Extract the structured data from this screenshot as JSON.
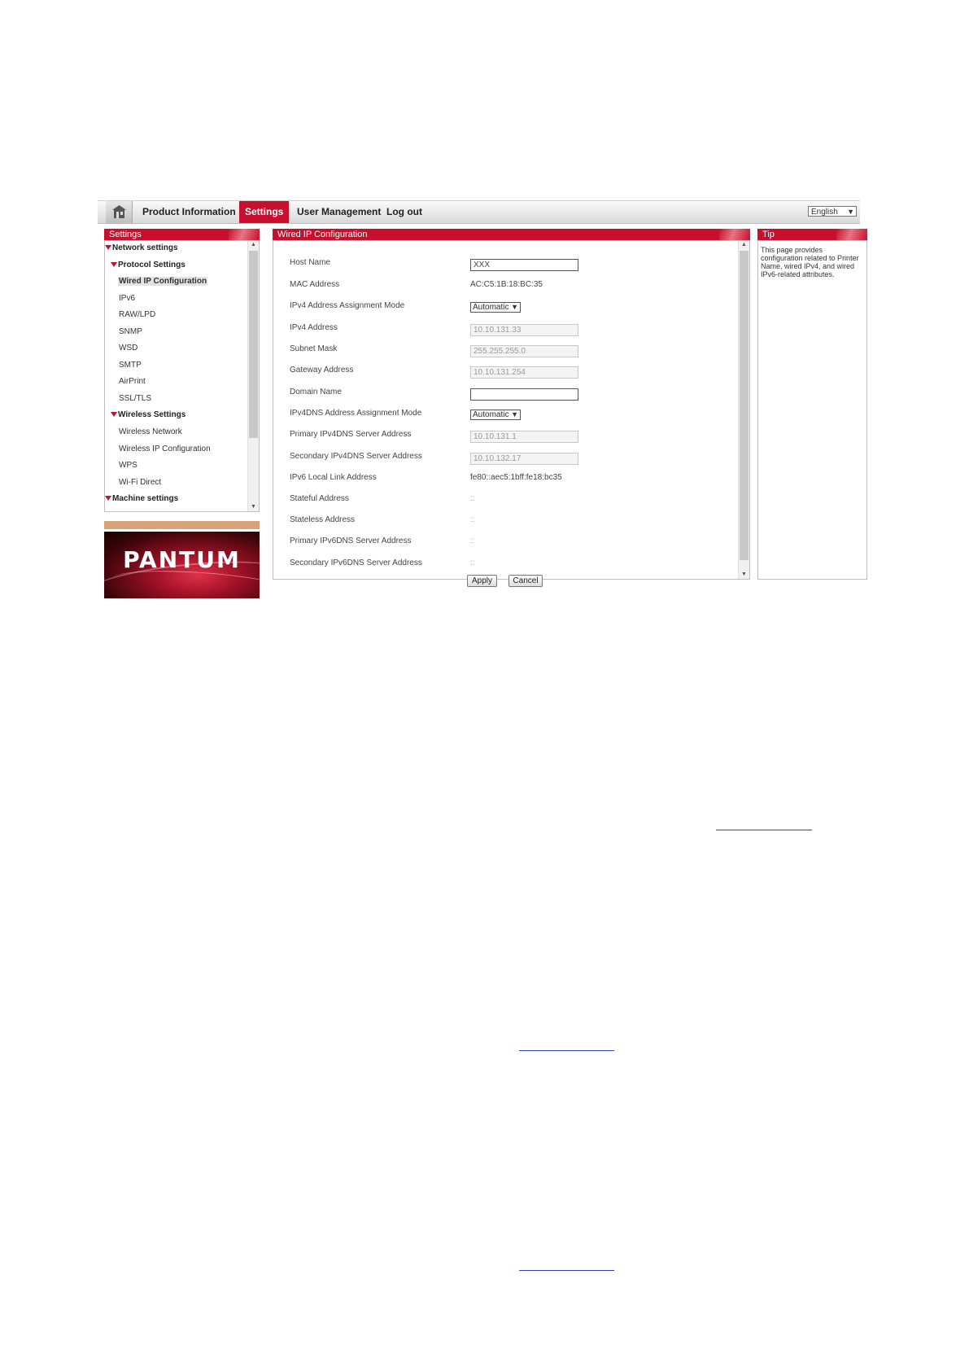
{
  "nav": {
    "items": [
      "Product Information",
      "Settings",
      "User Management",
      "Log out"
    ],
    "active": "Settings",
    "language": "English"
  },
  "sidebar": {
    "title": "Settings",
    "items": [
      {
        "label": "Network settings",
        "type": "group"
      },
      {
        "label": "Protocol Settings",
        "type": "group"
      },
      {
        "label": "Wired IP Configuration",
        "type": "item",
        "selected": true
      },
      {
        "label": "IPv6",
        "type": "item"
      },
      {
        "label": "RAW/LPD",
        "type": "item"
      },
      {
        "label": "SNMP",
        "type": "item"
      },
      {
        "label": "WSD",
        "type": "item"
      },
      {
        "label": "SMTP",
        "type": "item"
      },
      {
        "label": "AirPrint",
        "type": "item"
      },
      {
        "label": "SSL/TLS",
        "type": "item"
      },
      {
        "label": "Wireless Settings",
        "type": "group"
      },
      {
        "label": "Wireless Network",
        "type": "item"
      },
      {
        "label": "Wireless IP Configuration",
        "type": "item"
      },
      {
        "label": "WPS",
        "type": "item"
      },
      {
        "label": "Wi-Fi Direct",
        "type": "item"
      },
      {
        "label": "Machine settings",
        "type": "group"
      }
    ]
  },
  "brand": {
    "logo_text": "PANTUM"
  },
  "main": {
    "title": "Wired IP Configuration",
    "fields": [
      {
        "label": "Host Name",
        "kind": "input",
        "value": "XXX"
      },
      {
        "label": "MAC Address",
        "kind": "text",
        "value": "AC:C5:1B:18:BC:35"
      },
      {
        "label": "IPv4 Address Assignment Mode",
        "kind": "select",
        "value": "Automatic"
      },
      {
        "label": "IPv4 Address",
        "kind": "input-disabled",
        "value": "10.10.131.33"
      },
      {
        "label": "Subnet Mask",
        "kind": "input-disabled",
        "value": "255.255.255.0"
      },
      {
        "label": "Gateway Address",
        "kind": "input-disabled",
        "value": "10.10.131.254"
      },
      {
        "label": "Domain Name",
        "kind": "input",
        "value": ""
      },
      {
        "label": "IPv4DNS Address Assignment Mode",
        "kind": "select",
        "value": "Automatic"
      },
      {
        "label": "Primary IPv4DNS Server Address",
        "kind": "input-disabled",
        "value": "10.10.131.1"
      },
      {
        "label": "Secondary IPv4DNS Server Address",
        "kind": "input-disabled",
        "value": "10.10.132.17"
      },
      {
        "label": "IPv6 Local Link Address",
        "kind": "text",
        "value": "fe80::aec5:1bff:fe18:bc35"
      },
      {
        "label": "Stateful Address",
        "kind": "text-light",
        "value": "::"
      },
      {
        "label": "Stateless Address",
        "kind": "text-light",
        "value": "::"
      },
      {
        "label": "Primary IPv6DNS Server Address",
        "kind": "text-light",
        "value": "::"
      },
      {
        "label": "Secondary IPv6DNS Server Address",
        "kind": "text-light",
        "value": "::"
      }
    ],
    "apply_label": "Apply",
    "cancel_label": "Cancel"
  },
  "tip": {
    "title": "Tip",
    "text": "This page provides configuration related to Printer Name, wired IPv4, and wired IPv6-related attributes."
  }
}
